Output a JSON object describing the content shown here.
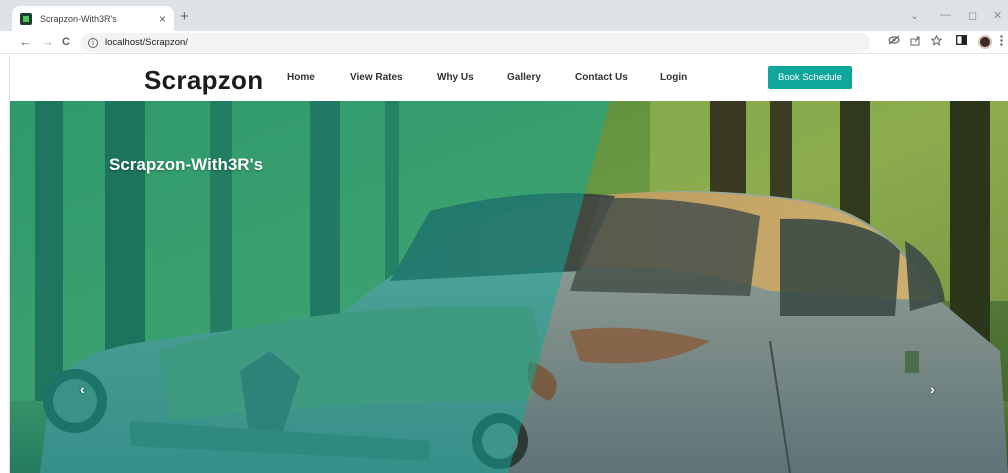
{
  "browser": {
    "tab_title": "Scrapzon-With3R's",
    "tab_close": "×",
    "new_tab": "+",
    "url": "localhost/Scrapzon/",
    "back": "←",
    "forward": "→",
    "reload": "C",
    "info": "i",
    "win_collapse": "⌄",
    "win_min": "—",
    "win_max": "◻",
    "win_close": "✕",
    "icons": [
      "eye-off-icon",
      "share-icon",
      "star-icon",
      "sidebar-icon",
      "profile-avatar",
      "menu-icon"
    ]
  },
  "navbar": {
    "brand": "Scrapzon",
    "links": [
      "Home",
      "View Rates",
      "Why Us",
      "Gallery",
      "Contact Us",
      "Login"
    ],
    "cta": "Book Schedule"
  },
  "hero": {
    "title": "Scrapzon-With3R's",
    "prev": "‹",
    "next": "›",
    "overlay_color": "#11a89a"
  },
  "colors": {
    "accent": "#0fa79b"
  }
}
